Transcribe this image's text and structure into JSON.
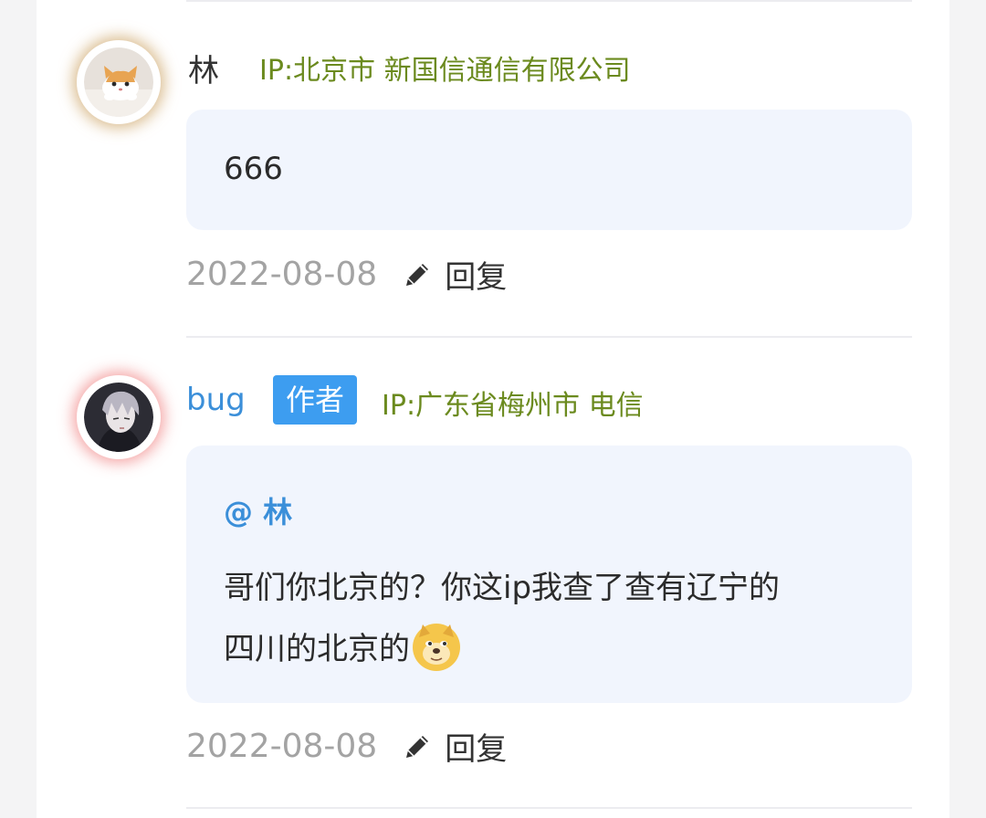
{
  "comments": [
    {
      "name": "林",
      "ip": "IP:北京市 新国信通信有限公司",
      "text": "666",
      "date": "2022-08-08",
      "reply_label": "回复",
      "avatar_icon": "cat-avatar"
    },
    {
      "name": "bug",
      "badge": "作者",
      "ip": "IP:广东省梅州市 电信",
      "quote": "@ 林",
      "text_line1": "哥们你北京的？你这ip我查了查有辽宁的",
      "text_line2": "四川的北京的",
      "emoji": "doge-emoji",
      "date": "2022-08-08",
      "reply_label": "回复",
      "avatar_icon": "anime-character-avatar"
    }
  ],
  "colors": {
    "ip_text": "#6b8a1e",
    "author_badge": "#3d9df0",
    "link_blue": "#3b8fd9",
    "bubble_bg": "#f1f5fd",
    "date_gray": "#a3a3a3"
  }
}
